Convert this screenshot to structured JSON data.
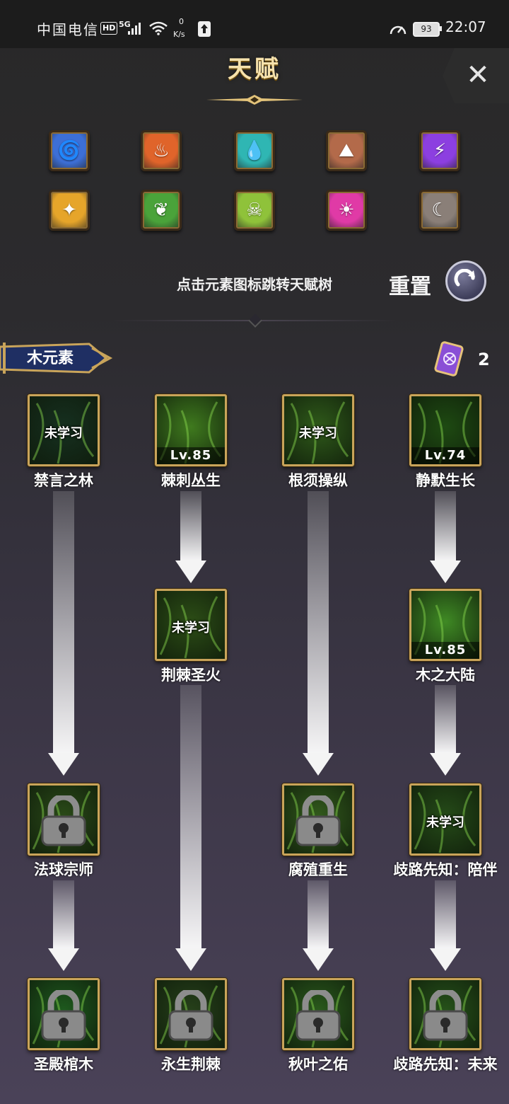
{
  "status_bar": {
    "carrier": "中国电信",
    "hd": "HD",
    "network": "5G",
    "speed_value": "0",
    "speed_unit": "K/s",
    "battery": "93",
    "time": "22:07"
  },
  "header": {
    "title": "天赋"
  },
  "elements": [
    {
      "name": "wind",
      "color": "#3d6fd6",
      "icon": "tornado-icon"
    },
    {
      "name": "fire",
      "color": "#e0642a",
      "icon": "flame-icon"
    },
    {
      "name": "water",
      "color": "#2fb6b3",
      "icon": "droplet-icon"
    },
    {
      "name": "earth",
      "color": "#b36a4a",
      "icon": "rock-icon"
    },
    {
      "name": "thunder",
      "color": "#8c3fe0",
      "icon": "lightning-icon"
    },
    {
      "name": "light",
      "color": "#e6a52a",
      "icon": "gem-icon"
    },
    {
      "name": "wood",
      "color": "#4aa33a",
      "icon": "leaf-icon"
    },
    {
      "name": "poison",
      "color": "#8fc23a",
      "icon": "skull-icon"
    },
    {
      "name": "holy",
      "color": "#e03aa6",
      "icon": "sun-icon"
    },
    {
      "name": "dark",
      "color": "#8a7f78",
      "icon": "moon-icon"
    }
  ],
  "hint": "点击元素图标跳转天赋树",
  "reset_label": "重置",
  "current_element": "木元素",
  "scroll_count": "2",
  "nodes": [
    {
      "id": "n1",
      "name": "禁言之林",
      "status": "未学习",
      "level": "",
      "locked": false,
      "bg": "#163020"
    },
    {
      "id": "n2",
      "name": "棘刺丛生",
      "status": "",
      "level": "Lv.85",
      "locked": false,
      "bg": "#3f7a1e"
    },
    {
      "id": "n3",
      "name": "根须操纵",
      "status": "未学习",
      "level": "",
      "locked": false,
      "bg": "#2f5a1a"
    },
    {
      "id": "n4",
      "name": "静默生长",
      "status": "",
      "level": "Lv.74",
      "locked": false,
      "bg": "#1e4a12"
    },
    {
      "id": "n5",
      "name": "荆棘圣火",
      "status": "未学习",
      "level": "",
      "locked": false,
      "bg": "#2c4d16"
    },
    {
      "id": "n6",
      "name": "木之大陆",
      "status": "",
      "level": "Lv.85",
      "locked": false,
      "bg": "#3f8a24"
    },
    {
      "id": "n7",
      "name": "法球宗师",
      "status": "",
      "level": "",
      "locked": true,
      "bg": "#2a4a18"
    },
    {
      "id": "n8",
      "name": "腐殖重生",
      "status": "",
      "level": "",
      "locked": true,
      "bg": "#325a1c"
    },
    {
      "id": "n9",
      "name": "歧路先知：陪伴",
      "status": "未学习",
      "level": "",
      "locked": false,
      "bg": "#254b18"
    },
    {
      "id": "n10",
      "name": "圣殿棺木",
      "status": "",
      "level": "",
      "locked": true,
      "bg": "#1e5a1e"
    },
    {
      "id": "n11",
      "name": "永生荆棘",
      "status": "",
      "level": "",
      "locked": true,
      "bg": "#26401a"
    },
    {
      "id": "n12",
      "name": "秋叶之佑",
      "status": "",
      "level": "",
      "locked": true,
      "bg": "#2a5a1c"
    },
    {
      "id": "n13",
      "name": "歧路先知：未来",
      "status": "",
      "level": "",
      "locked": true,
      "bg": "#26521a"
    }
  ]
}
